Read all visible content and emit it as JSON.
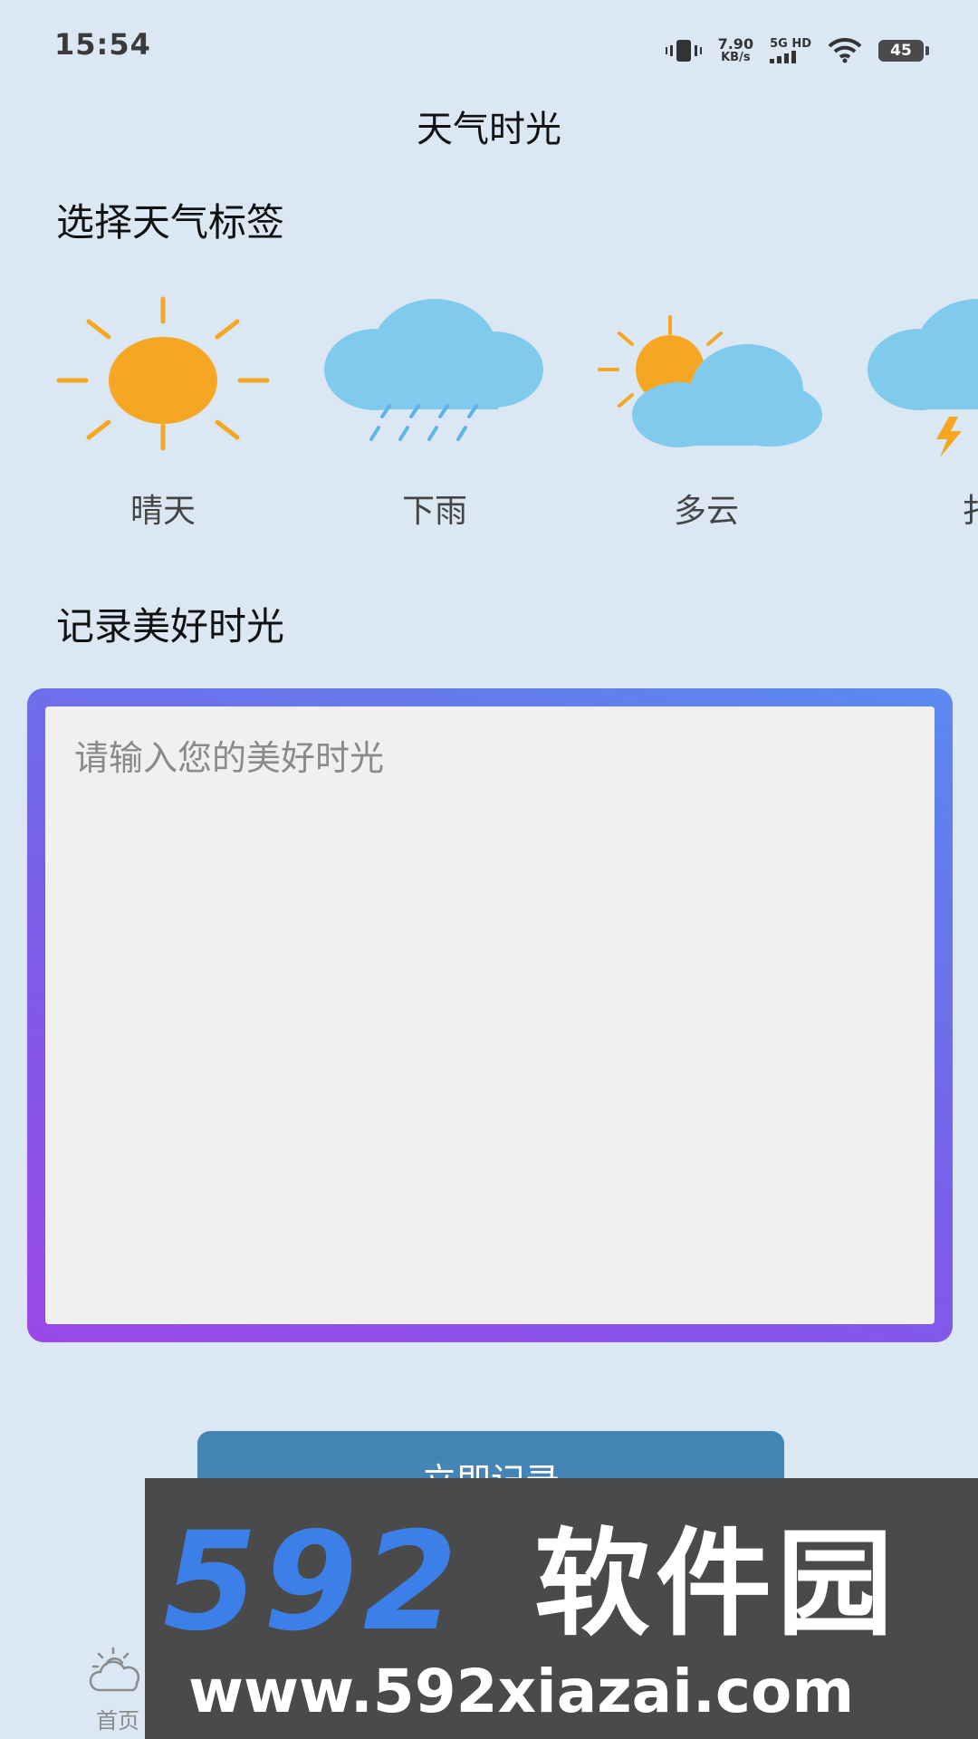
{
  "status_bar": {
    "time": "15:54",
    "speed_value": "7.90",
    "speed_unit": "KB/s",
    "network": "5G HD",
    "battery": "45"
  },
  "app": {
    "title": "天气时光"
  },
  "weather_section": {
    "heading": "选择天气标签",
    "tags": [
      {
        "label": "晴天",
        "icon": "sun-icon"
      },
      {
        "label": "下雨",
        "icon": "rain-icon"
      },
      {
        "label": "多云",
        "icon": "partly-cloudy-icon"
      },
      {
        "label": "扌",
        "icon": "thunderstorm-icon"
      }
    ]
  },
  "record_section": {
    "heading": "记录美好时光",
    "placeholder": "请输入您的美好时光"
  },
  "record_button": {
    "label": "立即记录"
  },
  "bottom_nav": {
    "home_label": "首页"
  },
  "watermark": {
    "number": "592",
    "brand": "软件园",
    "url": "www.592xiazai.com"
  },
  "colors": {
    "background": "#dbe8f3",
    "sun": "#f5a623",
    "cloud": "#7fcaed",
    "rain": "#5fb3e6",
    "button": "#4585b5",
    "border_gradient_start": "#5a8af0",
    "border_gradient_end": "#9a48e8"
  }
}
